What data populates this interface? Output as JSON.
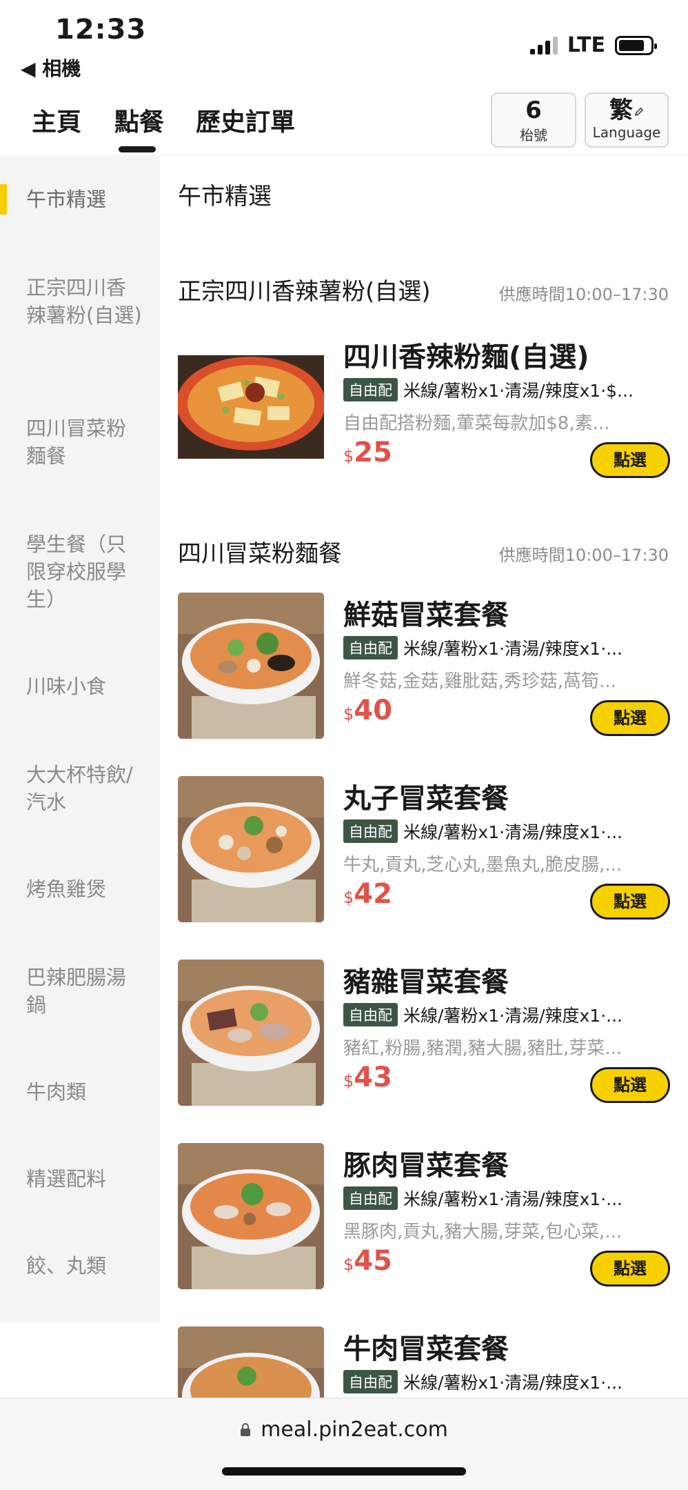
{
  "status_bar": {
    "time": "12:33",
    "back_label": "◀ 相機",
    "network": "LTE"
  },
  "nav": {
    "tabs": [
      "主頁",
      "點餐",
      "歷史訂單"
    ],
    "table_number": "6",
    "table_label": "枱號",
    "language_main": "繁",
    "language_label": "Language"
  },
  "sidebar": {
    "items": [
      "午市精選",
      "正宗四川香辣薯粉(自選)",
      "四川冒菜粉麵餐",
      "學生餐（只限穿校服學生）",
      "川味小食",
      "大大杯特飲/汽水",
      "烤魚雞煲",
      "巴辣肥腸湯鍋",
      "牛肉類",
      "精選配料",
      "餃、丸類"
    ]
  },
  "main": {
    "header": "午市精選",
    "sections": [
      {
        "title": "正宗四川香辣薯粉(自選)",
        "time": "供應時間10:00–17:30"
      },
      {
        "title": "四川冒菜粉麵餐",
        "time": "供應時間10:00–17:30"
      }
    ],
    "products": [
      {
        "name": "四川香辣粉麵(自選)",
        "tag": "自由配",
        "options": "米線/薯粉x1·清湯/辣度x1·$...",
        "desc": "自由配搭粉麵,葷菜每款加$8,素...",
        "currency": "$",
        "price": "25",
        "button": "點選"
      },
      {
        "name": "鮮菇冒菜套餐",
        "tag": "自由配",
        "options": "米線/薯粉x1·清湯/辣度x1·...",
        "desc": "鮮冬菇,金菇,雞肶菇,秀珍菇,萵筍...",
        "currency": "$",
        "price": "40",
        "button": "點選"
      },
      {
        "name": "丸子冒菜套餐",
        "tag": "自由配",
        "options": "米線/薯粉x1·清湯/辣度x1·...",
        "desc": "牛丸,貢丸,芝心丸,墨魚丸,脆皮腸,...",
        "currency": "$",
        "price": "42",
        "button": "點選"
      },
      {
        "name": "豬雜冒菜套餐",
        "tag": "自由配",
        "options": "米線/薯粉x1·清湯/辣度x1·...",
        "desc": "豬紅,粉腸,豬潤,豬大腸,豬肚,芽菜...",
        "currency": "$",
        "price": "43",
        "button": "點選"
      },
      {
        "name": "豚肉冒菜套餐",
        "tag": "自由配",
        "options": "米線/薯粉x1·清湯/辣度x1·...",
        "desc": "黑豚肉,貢丸,豬大腸,芽菜,包心菜,...",
        "currency": "$",
        "price": "45",
        "button": "點選"
      },
      {
        "name": "牛肉冒菜套餐",
        "tag": "自由配",
        "options": "米線/薯粉x1·清湯/辣度x1·..."
      }
    ]
  },
  "browser": {
    "url": "meal.pin2eat.com"
  },
  "colors": {
    "accent": "#f7d000",
    "price": "#e0524a",
    "tag_bg": "#3d5545",
    "sidebar_bg": "#f4f4f4"
  }
}
